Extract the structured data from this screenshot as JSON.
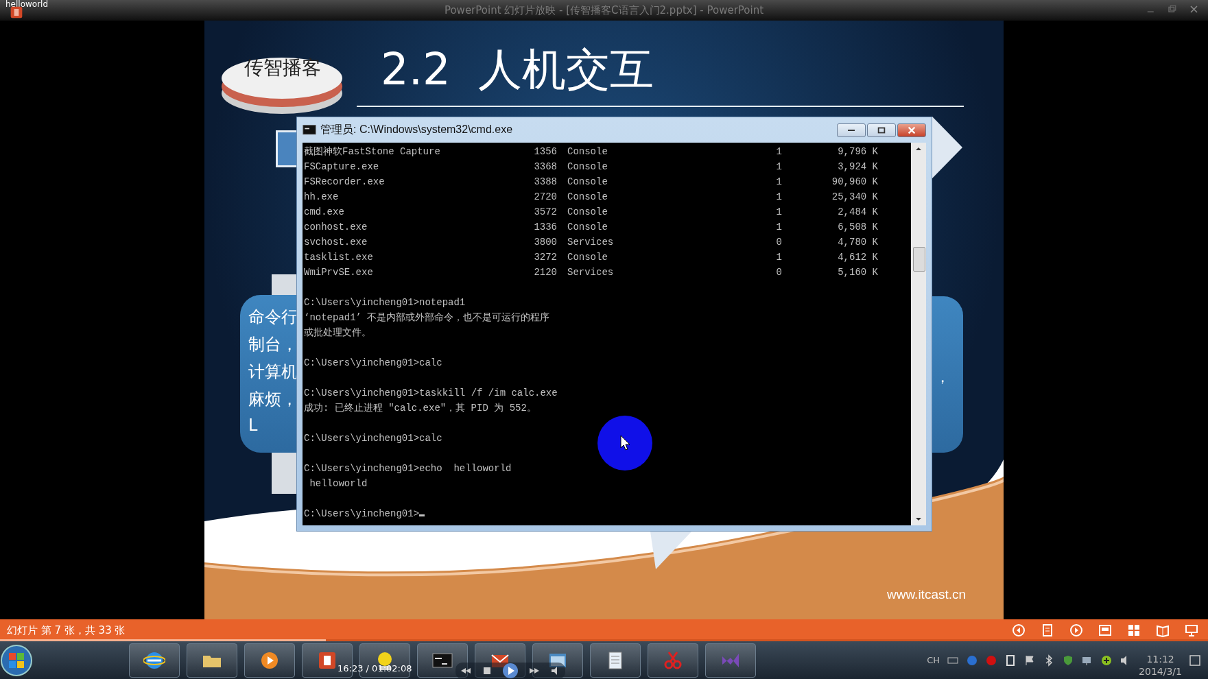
{
  "top_bar": {
    "corner_text": "helloworld",
    "title": "PowerPoint 幻灯片放映 - [传智播客C语言入门2.pptx] - PowerPoint"
  },
  "slide": {
    "logo_text": "传智播客",
    "title": "2.2  人机交互",
    "left_callout_lines": [
      "命令行",
      "制台，",
      "计算机",
      "麻烦，",
      "L"
    ],
    "right_callout_text": "，",
    "footer_url": "www.itcast.cn"
  },
  "cmd_window": {
    "title": "管理员: C:\\Windows\\system32\\cmd.exe",
    "processes": [
      {
        "name": "截图神软FastStone Capture",
        "pid": "1356",
        "session": "Console",
        "session_no": "1",
        "memory": "9,796 K"
      },
      {
        "name": "FSCapture.exe",
        "pid": "3368",
        "session": "Console",
        "session_no": "1",
        "memory": "3,924 K"
      },
      {
        "name": "FSRecorder.exe",
        "pid": "3388",
        "session": "Console",
        "session_no": "1",
        "memory": "90,960 K"
      },
      {
        "name": "hh.exe",
        "pid": "2720",
        "session": "Console",
        "session_no": "1",
        "memory": "25,340 K"
      },
      {
        "name": "cmd.exe",
        "pid": "3572",
        "session": "Console",
        "session_no": "1",
        "memory": "2,484 K"
      },
      {
        "name": "conhost.exe",
        "pid": "1336",
        "session": "Console",
        "session_no": "1",
        "memory": "6,508 K"
      },
      {
        "name": "svchost.exe",
        "pid": "3800",
        "session": "Services",
        "session_no": "0",
        "memory": "4,780 K"
      },
      {
        "name": "tasklist.exe",
        "pid": "3272",
        "session": "Console",
        "session_no": "1",
        "memory": "4,612 K"
      },
      {
        "name": "WmiPrvSE.exe",
        "pid": "2120",
        "session": "Services",
        "session_no": "0",
        "memory": "5,160 K"
      }
    ],
    "blocks": [
      [
        "C:\\Users\\yincheng01>notepad1",
        "‘notepad1’ 不是内部或外部命令，也不是可运行的程序",
        "或批处理文件。"
      ],
      [
        "C:\\Users\\yincheng01>calc"
      ],
      [
        "C:\\Users\\yincheng01>taskkill /f /im calc.exe",
        "成功: 已终止进程 \"calc.exe\"，其 PID 为 552。"
      ],
      [
        "C:\\Users\\yincheng01>calc"
      ],
      [
        "C:\\Users\\yincheng01>echo  helloworld",
        " helloworld"
      ],
      [
        "C:\\Users\\yincheng01>"
      ]
    ]
  },
  "status_bar": {
    "text": "幻灯片 第 7 张，共 33 张",
    "level": 0.27
  },
  "taskbar": {
    "media_time": "16:23 / 01:02:08",
    "language": "CH",
    "clock_time": "11:12",
    "clock_date": "2014/3/1"
  }
}
